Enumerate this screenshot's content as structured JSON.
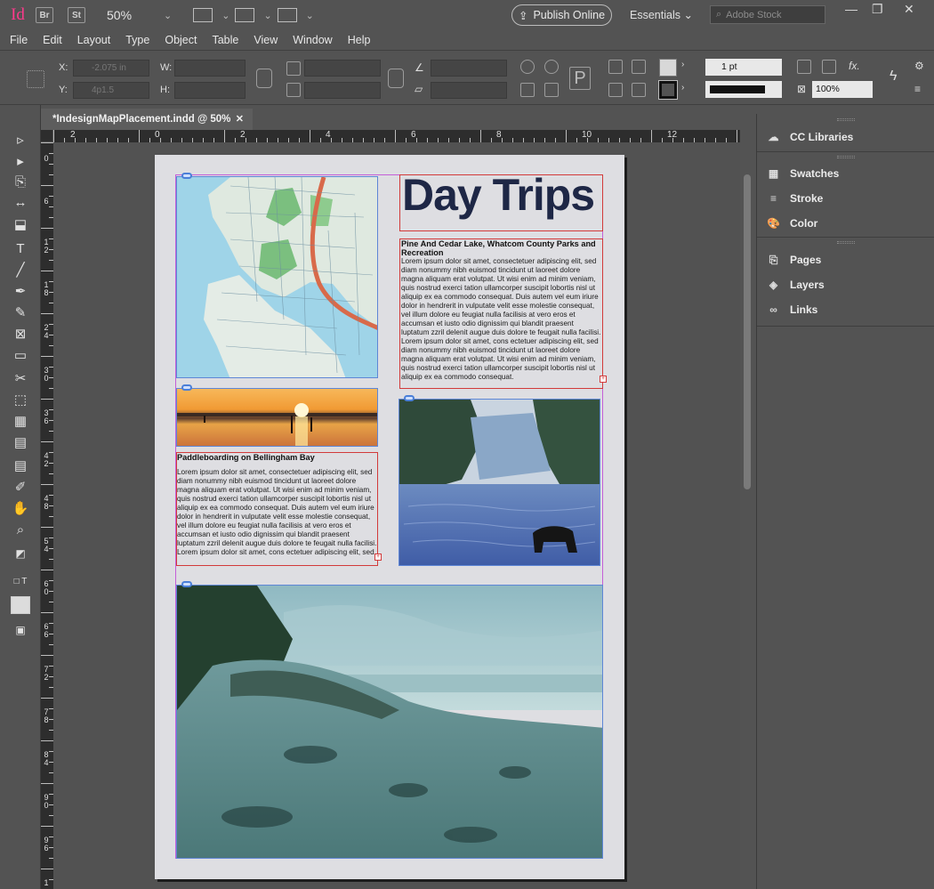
{
  "app": {
    "logo": "Id",
    "bridge": "Br",
    "stock_app": "St",
    "zoom": "50%",
    "publish": "Publish Online",
    "workspace": "Essentials",
    "search_placeholder": "Adobe Stock"
  },
  "menu": [
    "File",
    "Edit",
    "Layout",
    "Type",
    "Object",
    "Table",
    "View",
    "Window",
    "Help"
  ],
  "control": {
    "x_label": "X:",
    "y_label": "Y:",
    "w_label": "W:",
    "h_label": "H:",
    "x_value": "-2.075 in",
    "y_value": "4p1.5",
    "stroke_weight": "1 pt",
    "opacity": "100%"
  },
  "document": {
    "tab_title": "*IndesignMapPlacement.indd @ 50%",
    "close": "✕"
  },
  "ruler": {
    "h_labels": [
      "2",
      "0",
      "2",
      "4",
      "6",
      "8",
      "10",
      "12"
    ],
    "v_labels": [
      "0",
      "6",
      "12",
      "18",
      "24",
      "30",
      "36",
      "42",
      "48",
      "54",
      "60",
      "66",
      "72",
      "78",
      "84",
      "90",
      "96",
      "1"
    ]
  },
  "page": {
    "title": "Day Trips",
    "article1": {
      "heading": "Pine And Cedar Lake, Whatcom County Parks and Recreation",
      "body": "Lorem ipsum dolor sit amet, consectetuer adipiscing elit, sed diam nonummy nibh euismod tincidunt ut laoreet dolore magna aliquam erat volutpat. Ut wisi enim ad minim veniam, quis nostrud exerci tation ullamcorper suscipit lobortis nisl ut aliquip ex ea commodo consequat. Duis autem vel eum iriure dolor in hendrerit in vulputate velit esse molestie consequat, vel illum dolore eu feugiat nulla facilisis at vero eros et accumsan et iusto odio dignissim qui blandit praesent luptatum zzril delenit augue duis dolore te feugait nulla facilisi.",
      "body2": "Lorem ipsum dolor sit amet, cons ectetuer adipiscing elit, sed diam nonummy nibh euismod tincidunt ut laoreet dolore magna aliquam erat volutpat. Ut wisi enim ad minim veniam, quis nostrud exerci tation ullamcorper suscipit lobortis nisl ut aliquip ex ea commodo consequat."
    },
    "article2": {
      "heading": "Paddleboarding on Bellingham Bay",
      "body": "Lorem ipsum dolor sit amet, consectetuer adipiscing elit, sed diam nonummy nibh euismod tincidunt ut laoreet dolore magna aliquam erat volutpat. Ut wisi enim ad minim veniam, quis nostrud exerci tation ullamcorper suscipit lobortis nisl ut aliquip ex ea commodo consequat. Duis autem vel eum iriure dolor in hendrerit in vulputate velit esse molestie consequat, vel illum dolore eu feugiat nulla facilisis at vero eros et accumsan et iusto odio dignissim qui blandit praesent luptatum zzril delenit augue duis dolore te feugait nulla facilisi.",
      "body2": "Lorem ipsum dolor sit amet, cons ectetuer adipiscing elit, sed"
    }
  },
  "panel": {
    "items": [
      "CC Libraries",
      "Swatches",
      "Stroke",
      "Color",
      "Pages",
      "Layers",
      "Links"
    ]
  },
  "colors": {
    "title": "#1e2746",
    "frame": "#d23a3a",
    "accent_pink": "#ff3a8c"
  }
}
